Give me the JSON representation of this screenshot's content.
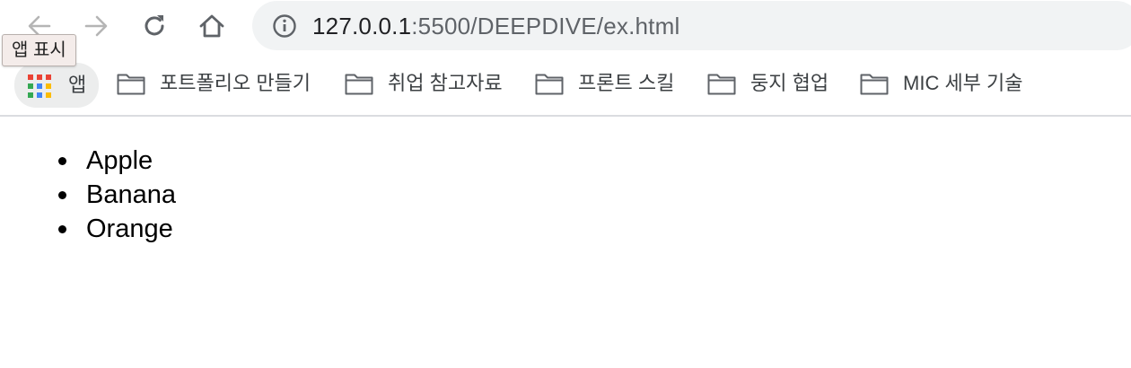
{
  "browser": {
    "url_host": "127.0.0.1",
    "url_rest": ":5500/DEEPDIVE/ex.html",
    "tooltip": "앱 표시"
  },
  "bookmarks": {
    "apps_label": "앱",
    "items": [
      {
        "label": "포트폴리오 만들기"
      },
      {
        "label": "취업 참고자료"
      },
      {
        "label": "프론트 스킬"
      },
      {
        "label": "둥지 협업"
      },
      {
        "label": "MIC 세부 기술"
      }
    ]
  },
  "page": {
    "list": [
      "Apple",
      "Banana",
      "Orange"
    ]
  },
  "colors": {
    "omnibox_bg": "#f1f3f4",
    "icon_disabled": "#b5b5b5",
    "icon_active": "#5f6368"
  }
}
